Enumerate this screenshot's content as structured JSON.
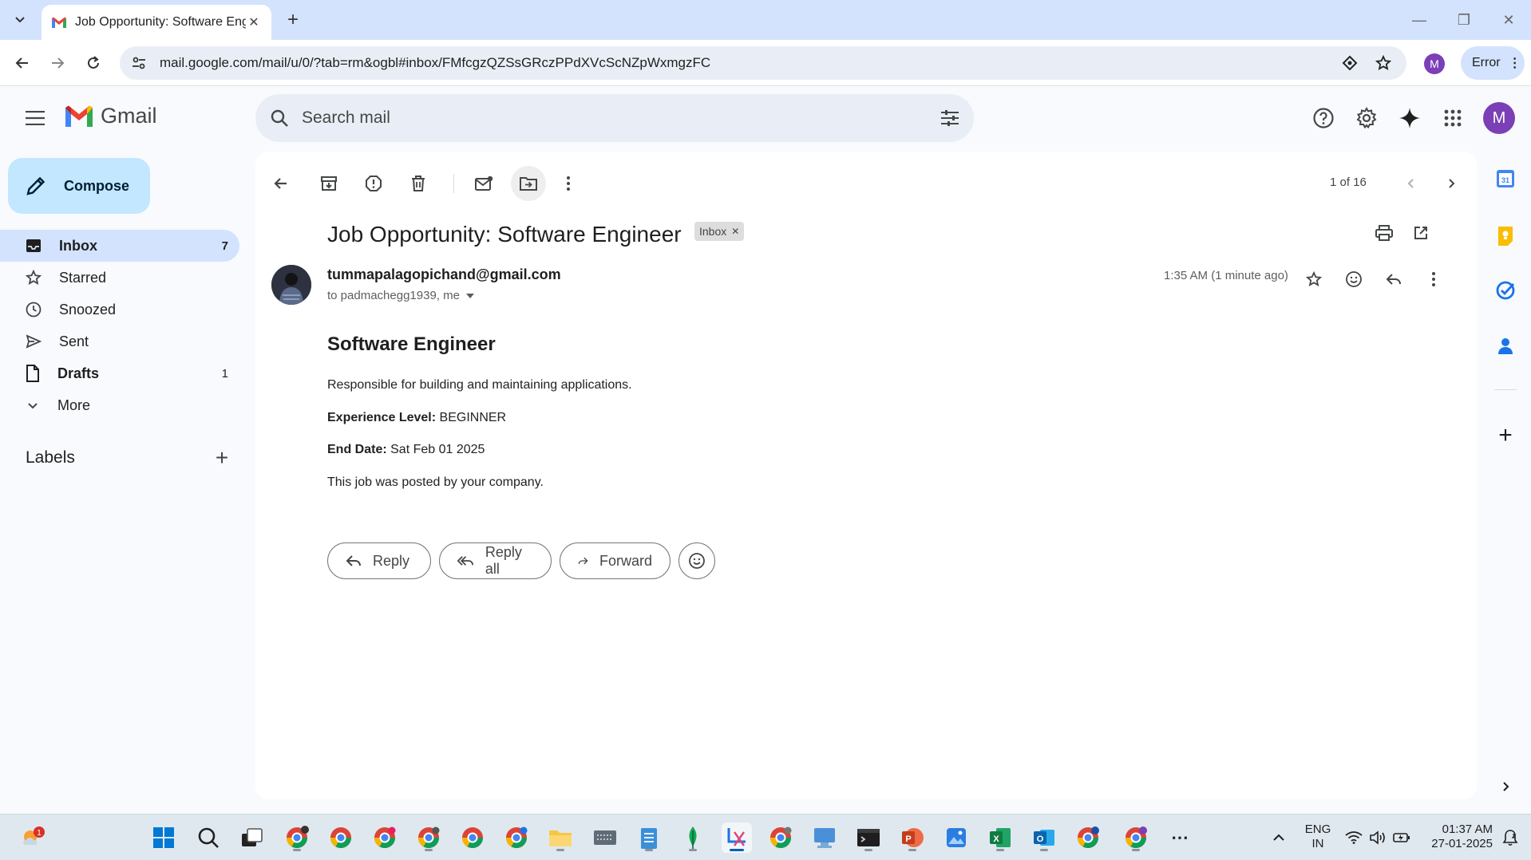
{
  "browser": {
    "tab_title": "Job Opportunity: Software Engi",
    "url": "mail.google.com/mail/u/0/?tab=rm&ogbl#inbox/FMfcgzQZSsGRczPPdXVcScNZpWxmgzFC",
    "profile_initial": "M",
    "error_label": "Error"
  },
  "gmail": {
    "logo_text": "Gmail",
    "search_placeholder": "Search mail",
    "account_initial": "M"
  },
  "sidebar": {
    "compose_label": "Compose",
    "items": [
      {
        "label": "Inbox",
        "count": "7"
      },
      {
        "label": "Starred",
        "count": ""
      },
      {
        "label": "Snoozed",
        "count": ""
      },
      {
        "label": "Sent",
        "count": ""
      },
      {
        "label": "Drafts",
        "count": "1"
      },
      {
        "label": "More",
        "count": ""
      }
    ],
    "labels_title": "Labels"
  },
  "toolbar": {
    "pager": "1 of 16"
  },
  "email": {
    "subject": "Job Opportunity: Software Engineer",
    "label_chip": "Inbox",
    "sender": "tummapalagopichand@gmail.com",
    "recipients": "to padmachegg1939, me",
    "timestamp": "1:35 AM (1 minute ago)",
    "body_title": "Software Engineer",
    "description": "Responsible for building and maintaining applications.",
    "experience_label": "Experience Level:",
    "experience_value": "BEGINNER",
    "end_date_label": "End Date:",
    "end_date_value": "Sat Feb 01 2025",
    "footer": "This job was posted by your company."
  },
  "actions": {
    "reply": "Reply",
    "reply_all": "Reply all",
    "forward": "Forward"
  },
  "taskbar": {
    "notification_count": "1",
    "lang_line1": "ENG",
    "lang_line2": "IN",
    "time": "01:37 AM",
    "date": "27-01-2025"
  },
  "colors": {
    "accent": "#0b57d0",
    "compose_bg": "#c2e7ff",
    "active_nav": "#d3e3fd"
  }
}
